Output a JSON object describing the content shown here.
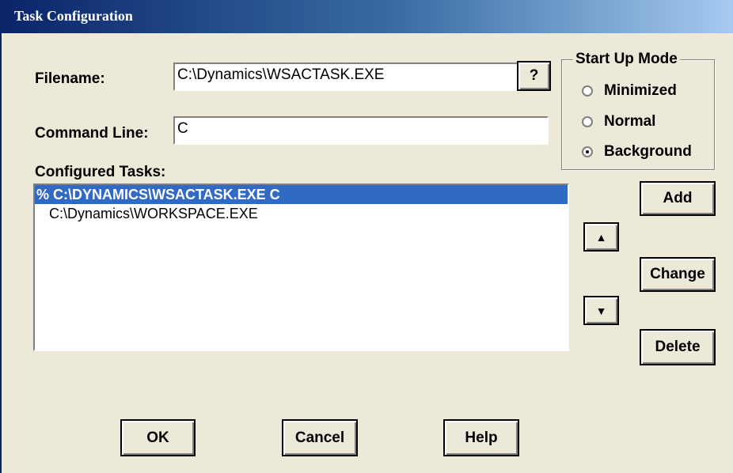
{
  "window": {
    "title": "Task Configuration"
  },
  "filename": {
    "label": "Filename:",
    "value": "C:\\Dynamics\\WSACTASK.EXE",
    "browse_label": "?"
  },
  "command_line": {
    "label": "Command Line:",
    "value": "C"
  },
  "startup": {
    "title": "Start Up Mode",
    "options": [
      {
        "label": "Minimized",
        "selected": false
      },
      {
        "label": "Normal",
        "selected": false
      },
      {
        "label": "Background",
        "selected": true
      }
    ]
  },
  "tasks": {
    "label": "Configured Tasks:",
    "items": [
      {
        "text": "% C:\\DYNAMICS\\WSACTASK.EXE  C",
        "selected": true
      },
      {
        "text": "C:\\Dynamics\\WORKSPACE.EXE",
        "selected": false
      }
    ]
  },
  "side_buttons": {
    "add": "Add",
    "change": "Change",
    "delete": "Delete"
  },
  "bottom_buttons": {
    "ok": "OK",
    "cancel": "Cancel",
    "help": "Help"
  }
}
